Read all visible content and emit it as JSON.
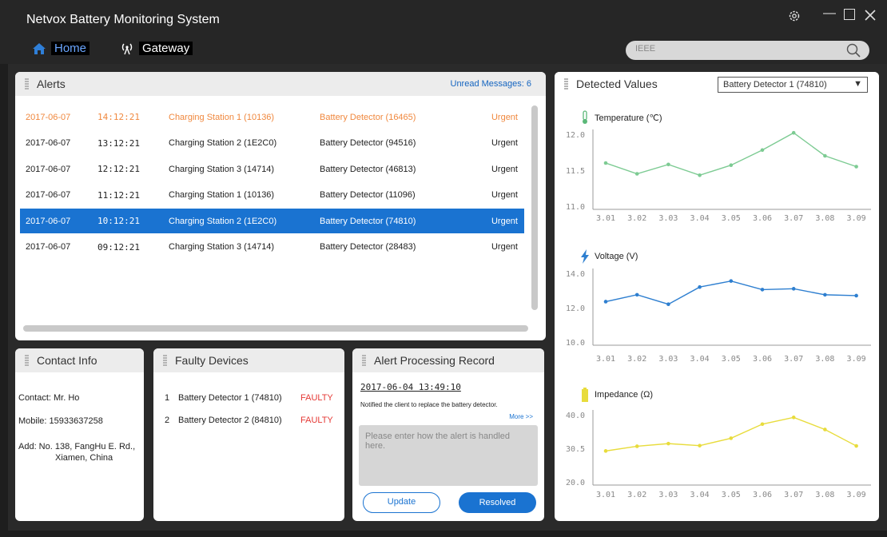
{
  "app": {
    "title": "Netvox Battery Monitoring System"
  },
  "nav": {
    "home": "Home",
    "gateway": "Gateway"
  },
  "search": {
    "value": "IEEE"
  },
  "alerts": {
    "title": "Alerts",
    "unread": "Unread Messages: 6",
    "rows": [
      {
        "date": "2017-06-07",
        "time": "14:12:21",
        "station": "Charging Station 1 (10136)",
        "detector": "Battery Detector (16465)",
        "level": "Urgent"
      },
      {
        "date": "2017-06-07",
        "time": "13:12:21",
        "station": "Charging Station 2 (1E2C0)",
        "detector": "Battery Detector (94516)",
        "level": "Urgent"
      },
      {
        "date": "2017-06-07",
        "time": "12:12:21",
        "station": "Charging Station 3 (14714)",
        "detector": "Battery Detector (46813)",
        "level": "Urgent"
      },
      {
        "date": "2017-06-07",
        "time": "11:12:21",
        "station": "Charging Station 1 (10136)",
        "detector": "Battery Detector (11096)",
        "level": "Urgent"
      },
      {
        "date": "2017-06-07",
        "time": "10:12:21",
        "station": "Charging Station 2 (1E2C0)",
        "detector": "Battery Detector (74810)",
        "level": "Urgent"
      },
      {
        "date": "2017-06-07",
        "time": "09:12:21",
        "station": "Charging Station 3 (14714)",
        "detector": "Battery Detector (28483)",
        "level": "Urgent"
      }
    ]
  },
  "contact": {
    "title": "Contact Info",
    "name": "Contact: Mr. Ho",
    "mobile": "Mobile: 15933637258",
    "address1": "Add: No. 138, FangHu E. Rd.,",
    "address2": "Xiamen, China"
  },
  "faulty": {
    "title": "Faulty Devices",
    "items": [
      {
        "num": "1",
        "name": "Battery Detector 1 (74810)",
        "status": "FAULTY"
      },
      {
        "num": "2",
        "name": "Battery Detector 2 (84810)",
        "status": "FAULTY"
      }
    ]
  },
  "record": {
    "title": "Alert Processing Record",
    "datetime": "2017-06-04  13:49:10",
    "note": "Notified the client to replace the battery detector.",
    "more": "More >>",
    "placeholder": "Please enter how the alert is handled here.",
    "update": "Update",
    "resolved": "Resolved"
  },
  "detected": {
    "title": "Detected Values",
    "device": "Battery Detector 1 (74810)"
  },
  "chart_data": [
    {
      "type": "line",
      "title": "Temperature (℃)",
      "categories": [
        "3.01",
        "3.02",
        "3.03",
        "3.04",
        "3.05",
        "3.06",
        "3.07",
        "3.08",
        "3.09"
      ],
      "values": [
        11.6,
        11.45,
        11.58,
        11.43,
        11.57,
        11.78,
        12.02,
        11.7,
        11.55
      ],
      "yticks": [
        "12.0",
        "11.5",
        "11.0"
      ],
      "ylim": [
        11.0,
        12.0
      ],
      "color": "#7dcb93"
    },
    {
      "type": "line",
      "title": "Voltage (V)",
      "categories": [
        "3.01",
        "3.02",
        "3.03",
        "3.04",
        "3.05",
        "3.06",
        "3.07",
        "3.08",
        "3.09"
      ],
      "values": [
        12.35,
        12.75,
        12.2,
        13.2,
        13.55,
        13.05,
        13.1,
        12.75,
        12.7
      ],
      "yticks": [
        "14.0",
        "12.0",
        "10.0"
      ],
      "ylim": [
        10.0,
        14.0
      ],
      "color": "#2e7fd0"
    },
    {
      "type": "line",
      "title": "Impedance (Ω)",
      "categories": [
        "3.01",
        "3.02",
        "3.03",
        "3.04",
        "3.05",
        "3.06",
        "3.07",
        "3.08",
        "3.09"
      ],
      "values": [
        29.2,
        30.6,
        31.4,
        30.8,
        33.0,
        37.2,
        39.2,
        35.6,
        30.7
      ],
      "yticks": [
        "40.0",
        "30.5",
        "20.0"
      ],
      "ylim": [
        20.0,
        40.0
      ],
      "color": "#e8dc3c"
    }
  ]
}
